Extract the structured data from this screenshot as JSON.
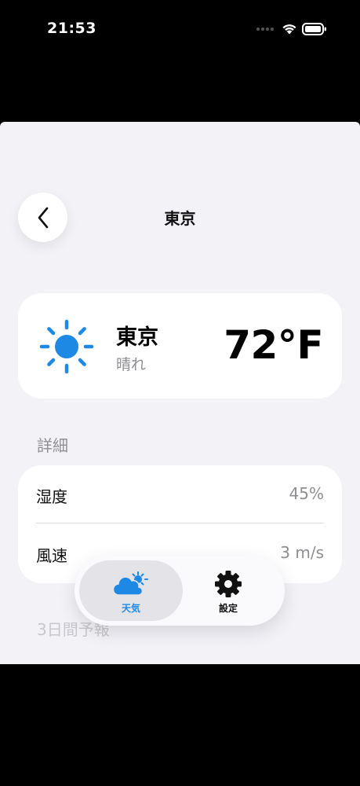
{
  "status_bar": {
    "time": "21:53"
  },
  "nav": {
    "title": "東京"
  },
  "weather": {
    "city": "東京",
    "condition": "晴れ",
    "temperature": "72°F",
    "icon": "sun-icon"
  },
  "details": {
    "header": "詳細",
    "rows": [
      {
        "label": "湿度",
        "value": "45%"
      },
      {
        "label": "風速",
        "value": "3 m/s"
      }
    ]
  },
  "forecast": {
    "header": "3日間予報"
  },
  "tab_bar": {
    "tabs": [
      {
        "label": "天気",
        "icon": "cloud-sun-icon",
        "active": true
      },
      {
        "label": "設定",
        "icon": "gear-icon",
        "active": false
      }
    ]
  },
  "colors": {
    "accent": "#1e88e5",
    "sheet_background": "#f2f2f7",
    "secondary_text": "#8e8e93"
  }
}
